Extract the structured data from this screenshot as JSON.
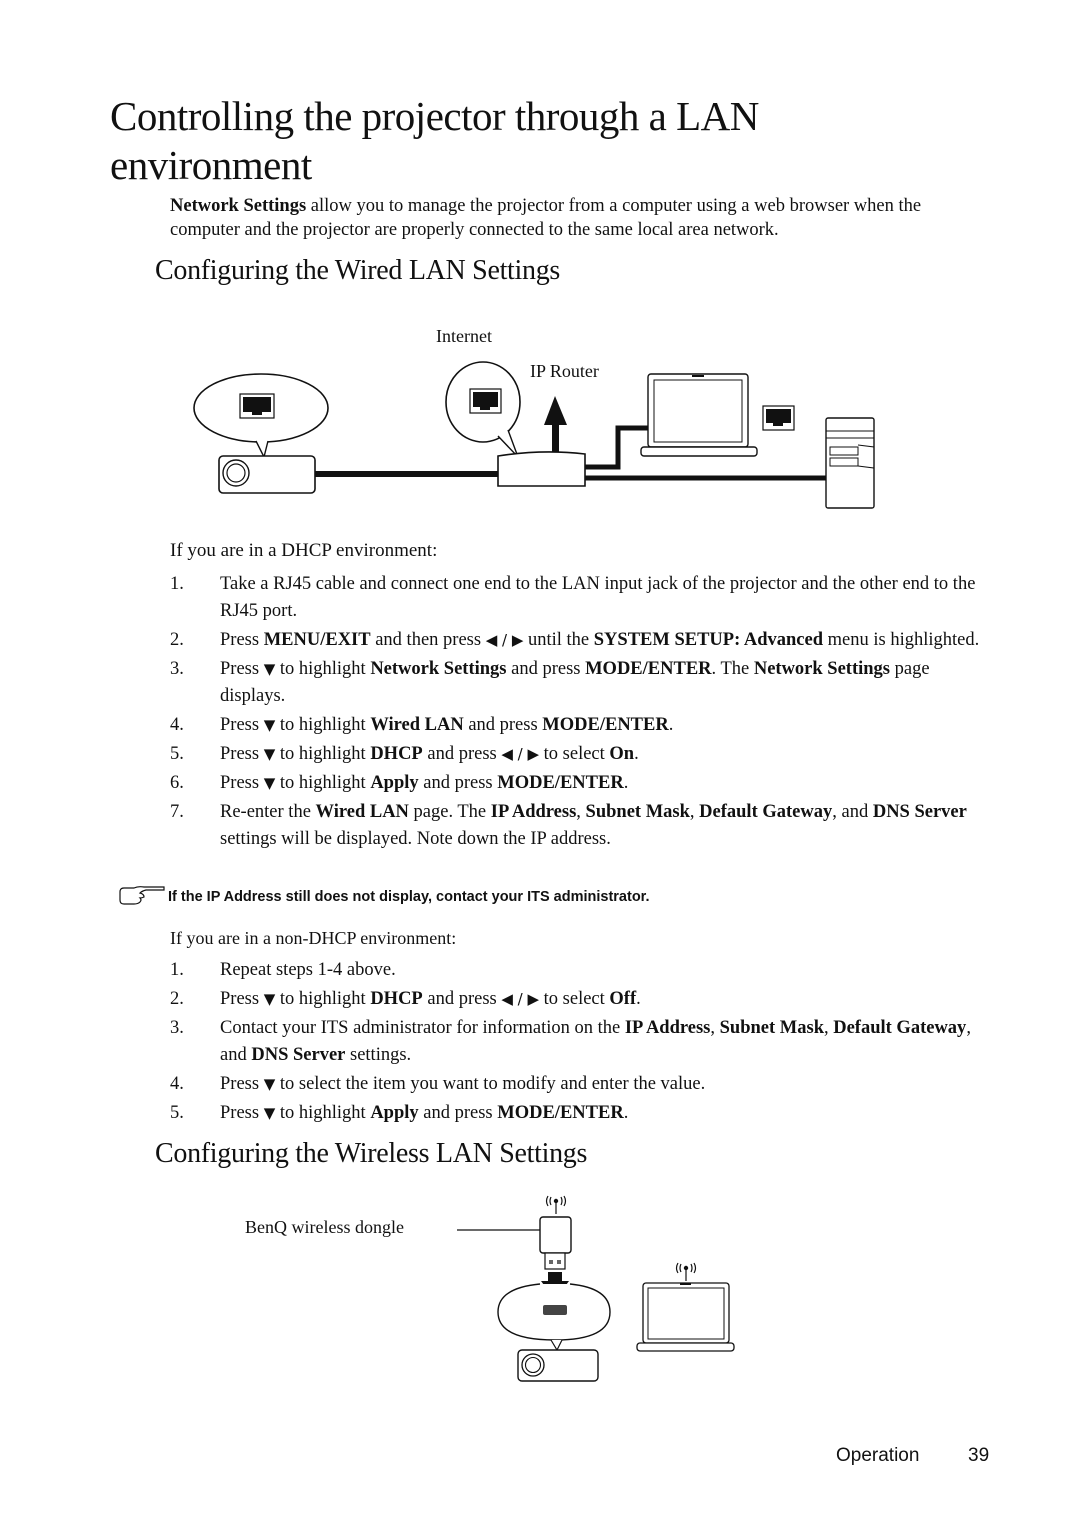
{
  "page": {
    "title": "Controlling the projector through a LAN environment",
    "intro": {
      "bold": "Network Settings",
      "rest": " allow you to manage the projector from a computer using a web browser when the computer and the projector are properly connected to the same local area network."
    }
  },
  "wired": {
    "heading": "Configuring the Wired LAN Settings",
    "diagram": {
      "label_internet": "Internet",
      "label_router": "IP Router",
      "icons": [
        "projector-icon",
        "rj45-port-icon",
        "router-icon",
        "up-arrow-icon",
        "laptop-icon",
        "desktop-pc-icon"
      ]
    },
    "dhcp": {
      "heading": "If you are in a DHCP environment:",
      "steps": [
        {
          "num": "1.",
          "parts": [
            {
              "t": "Take a RJ45 cable and connect one end to the LAN input jack of the projector and the other end to the RJ45 port."
            }
          ]
        },
        {
          "num": "2.",
          "parts": [
            {
              "t": "Press "
            },
            {
              "b": "MENU/EXIT"
            },
            {
              "t": " and then press "
            },
            {
              "i": "◀ / ▶"
            },
            {
              "t": " until the "
            },
            {
              "b": "SYSTEM SETUP: Advanced"
            },
            {
              "t": " menu is highlighted."
            }
          ]
        },
        {
          "num": "3.",
          "parts": [
            {
              "t": "Press "
            },
            {
              "i": "▼"
            },
            {
              "t": " to highlight "
            },
            {
              "b": "Network Settings"
            },
            {
              "t": " and press "
            },
            {
              "b": "MODE/ENTER"
            },
            {
              "t": ". The "
            },
            {
              "b": "Network Settings"
            },
            {
              "t": " page displays."
            }
          ]
        },
        {
          "num": "4.",
          "parts": [
            {
              "t": "Press "
            },
            {
              "i": "▼"
            },
            {
              "t": " to highlight "
            },
            {
              "b": "Wired LAN"
            },
            {
              "t": " and press "
            },
            {
              "b": "MODE/ENTER"
            },
            {
              "t": "."
            }
          ]
        },
        {
          "num": "5.",
          "parts": [
            {
              "t": "Press "
            },
            {
              "i": "▼"
            },
            {
              "t": " to highlight "
            },
            {
              "b": "DHCP"
            },
            {
              "t": " and press "
            },
            {
              "i": "◀ / ▶"
            },
            {
              "t": " to select "
            },
            {
              "b": "On"
            },
            {
              "t": "."
            }
          ]
        },
        {
          "num": "6.",
          "parts": [
            {
              "t": "Press "
            },
            {
              "i": "▼"
            },
            {
              "t": " to highlight "
            },
            {
              "b": "Apply"
            },
            {
              "t": " and press "
            },
            {
              "b": "MODE/ENTER"
            },
            {
              "t": "."
            }
          ]
        },
        {
          "num": "7.",
          "parts": [
            {
              "t": "Re-enter the "
            },
            {
              "b": "Wired LAN"
            },
            {
              "t": " page. The "
            },
            {
              "b": "IP Address"
            },
            {
              "t": ", "
            },
            {
              "b": "Subnet Mask"
            },
            {
              "t": ", "
            },
            {
              "b": "Default Gateway"
            },
            {
              "t": ", and "
            },
            {
              "b": "DNS Server"
            },
            {
              "t": " settings will be displayed. Note down the IP address."
            }
          ]
        }
      ]
    },
    "note": {
      "icon": "pointing-hand-icon",
      "text": "If the IP Address still does not display, contact your ITS administrator."
    },
    "non_dhcp": {
      "heading": "If you are in a non-DHCP environment:",
      "steps": [
        {
          "num": "1.",
          "parts": [
            {
              "t": "Repeat steps 1-4 above."
            }
          ]
        },
        {
          "num": "2.",
          "parts": [
            {
              "t": "Press "
            },
            {
              "i": "▼"
            },
            {
              "t": " to highlight "
            },
            {
              "b": "DHCP"
            },
            {
              "t": " and press "
            },
            {
              "i": "◀ / ▶"
            },
            {
              "t": " to select "
            },
            {
              "b": "Off"
            },
            {
              "t": "."
            }
          ]
        },
        {
          "num": "3.",
          "parts": [
            {
              "t": "Contact your ITS administrator for information on the "
            },
            {
              "b": "IP Address"
            },
            {
              "t": ", "
            },
            {
              "b": "Subnet Mask"
            },
            {
              "t": ", "
            },
            {
              "b": "Default Gateway"
            },
            {
              "t": ", and "
            },
            {
              "b": "DNS Server"
            },
            {
              "t": " settings."
            }
          ]
        },
        {
          "num": "4.",
          "parts": [
            {
              "t": "Press "
            },
            {
              "i": "▼"
            },
            {
              "t": " to select the item you want to modify and enter the value."
            }
          ]
        },
        {
          "num": "5.",
          "parts": [
            {
              "t": "Press "
            },
            {
              "i": "▼"
            },
            {
              "t": " to highlight "
            },
            {
              "b": "Apply"
            },
            {
              "t": " and press "
            },
            {
              "b": "MODE/ENTER"
            },
            {
              "t": "."
            }
          ]
        }
      ]
    }
  },
  "wireless": {
    "heading": "Configuring the Wireless LAN Settings",
    "diagram": {
      "label_dongle": "BenQ wireless dongle",
      "icons": [
        "wireless-dongle-icon",
        "wifi-signal-icon",
        "down-arrow-icon",
        "usb-port-icon",
        "projector-icon",
        "laptop-icon"
      ]
    }
  },
  "footer": {
    "section": "Operation",
    "page_number": "39"
  }
}
